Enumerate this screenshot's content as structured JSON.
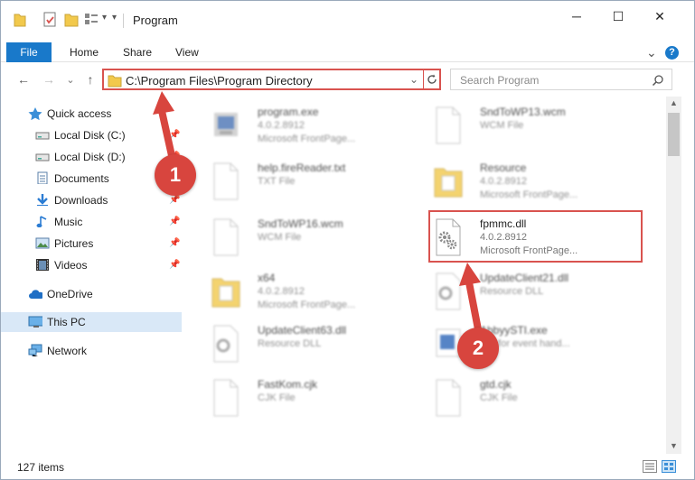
{
  "window": {
    "title": "Program",
    "controls": {
      "minimize": "─",
      "maximize": "☐",
      "close": "✕"
    }
  },
  "ribbon": {
    "tabs": [
      "File",
      "Home",
      "Share",
      "View"
    ],
    "expand_glyph": "⌄",
    "help_glyph": "?"
  },
  "nav": {
    "back_glyph": "←",
    "forward_glyph": "→",
    "recent_glyph": "⌄",
    "up_glyph": "↑",
    "address": "C:\\Program Files\\Program Directory",
    "search_placeholder": "Search Program"
  },
  "sidebar": {
    "items": [
      {
        "label": "Quick access",
        "icon": "star-icon"
      },
      {
        "label": "Local Disk (C:)",
        "icon": "drive-icon"
      },
      {
        "label": "Local Disk (D:)",
        "icon": "drive-icon"
      },
      {
        "label": "Documents",
        "icon": "documents-icon"
      },
      {
        "label": "Downloads",
        "icon": "downloads-icon"
      },
      {
        "label": "Music",
        "icon": "music-icon"
      },
      {
        "label": "Pictures",
        "icon": "pictures-icon"
      },
      {
        "label": "Videos",
        "icon": "videos-icon"
      },
      {
        "label": "OneDrive",
        "icon": "onedrive-icon"
      },
      {
        "label": "This PC",
        "icon": "computer-icon"
      },
      {
        "label": "Network",
        "icon": "network-icon"
      }
    ]
  },
  "files": [
    {
      "name": "program.exe",
      "line1": "4.0.2.8912",
      "line2": "Microsoft FrontPage..."
    },
    {
      "name": "SndToWP13.wcm",
      "line1": "WCM File",
      "line2": ""
    },
    {
      "name": "help.fireReader.txt",
      "line1": "TXT File",
      "line2": ""
    },
    {
      "name": "Resource",
      "line1": "4.0.2.8912",
      "line2": "Microsoft FrontPage..."
    },
    {
      "name": "SndToWP16.wcm",
      "line1": "WCM File",
      "line2": ""
    },
    {
      "name": "fpmmc.dll",
      "line1": "4.0.2.8912",
      "line2": "Microsoft FrontPage..."
    },
    {
      "name": "x64",
      "line1": "4.0.2.8912",
      "line2": "Microsoft FrontPage..."
    },
    {
      "name": "UpdateClient21.dll",
      "line1": "Resource DLL",
      "line2": ""
    },
    {
      "name": "UpdateClient63.dll",
      "line1": "Resource DLL",
      "line2": ""
    },
    {
      "name": "AbbyySTI.exe",
      "line1": "STI for event hand...",
      "line2": ""
    },
    {
      "name": "FastKom.cjk",
      "line1": "CJK File",
      "line2": ""
    },
    {
      "name": "gtd.cjk",
      "line1": "CJK File",
      "line2": ""
    }
  ],
  "status": {
    "item_count": "127 items"
  },
  "annotations": {
    "step1": "1",
    "step2": "2"
  },
  "colors": {
    "accent": "#1979ca",
    "highlight": "#d9534f",
    "callout": "#d8453e",
    "folder": "#f2c94c"
  }
}
